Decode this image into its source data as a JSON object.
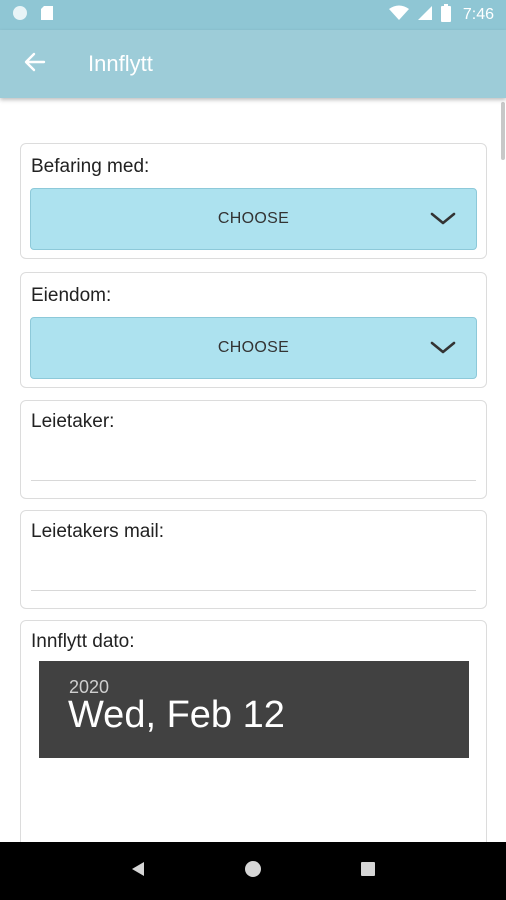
{
  "status_bar": {
    "time": "7:46"
  },
  "app_bar": {
    "title": "Innflytt"
  },
  "form": {
    "befaring": {
      "label": "Befaring med:",
      "value": "CHOOSE"
    },
    "eiendom": {
      "label": "Eiendom:",
      "value": "CHOOSE"
    },
    "leietaker": {
      "label": "Leietaker:",
      "value": ""
    },
    "leietaker_mail": {
      "label": "Leietakers mail:",
      "value": ""
    },
    "innflytt_dato": {
      "label": "Innflytt dato:",
      "year": "2020",
      "date": "Wed, Feb 12"
    }
  },
  "colors": {
    "app_bar": "#9dccd8",
    "status_bar": "#8fc6d4",
    "select_fill": "#ade2ef",
    "date_header": "#414141"
  },
  "icons": {
    "back": "arrow-left",
    "dropdown": "chevron-down",
    "nav_back": "triangle-left",
    "nav_home": "circle",
    "nav_recents": "square"
  }
}
